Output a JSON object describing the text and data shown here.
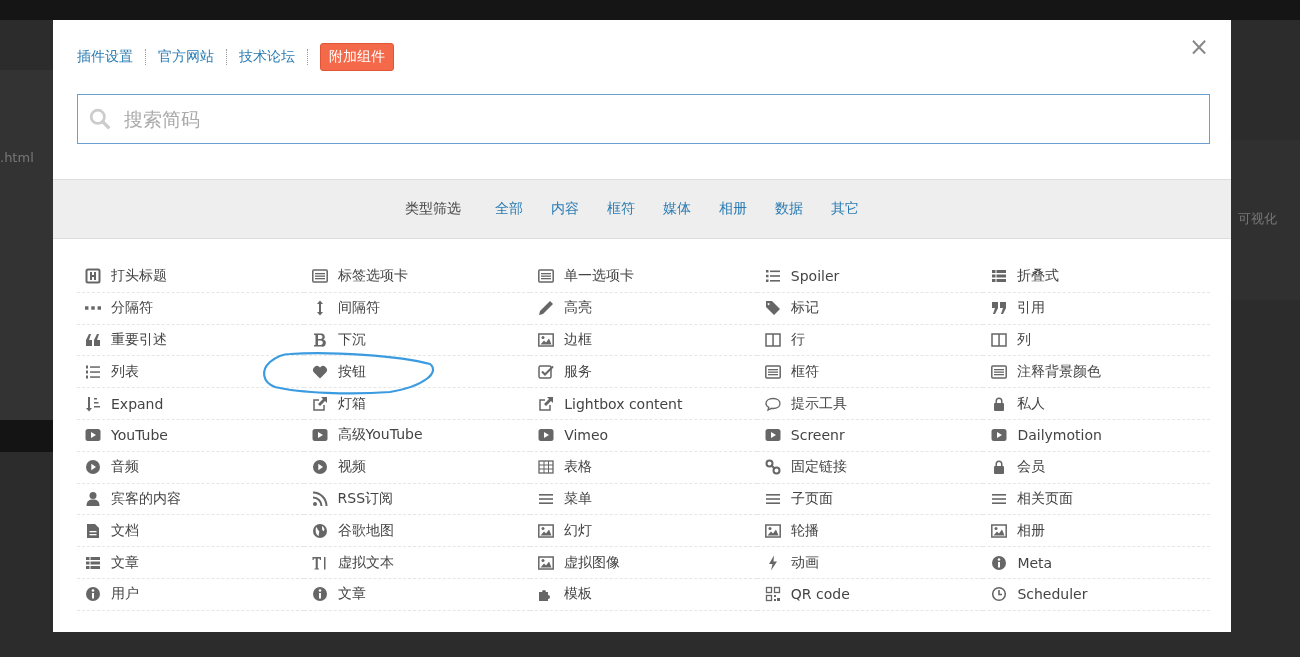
{
  "backdrop": {
    "left_text": ".html",
    "right_text": "可视化"
  },
  "header": {
    "links": [
      "插件设置",
      "官方网站",
      "技术论坛"
    ],
    "addon_button": "附加组件",
    "close": "×"
  },
  "search": {
    "placeholder": "搜索简码"
  },
  "filter": {
    "label": "类型筛选",
    "options": [
      "全部",
      "内容",
      "框符",
      "媒体",
      "相册",
      "数据",
      "其它"
    ]
  },
  "items": [
    {
      "kind": "heading",
      "label": "打头标题",
      "circled": false
    },
    {
      "kind": "list-alt",
      "label": "标签选项卡",
      "circled": false
    },
    {
      "kind": "list-alt",
      "label": "单一选项卡",
      "circled": false
    },
    {
      "kind": "list-ul",
      "label": "Spoiler",
      "circled": false
    },
    {
      "kind": "th-list",
      "label": "折叠式",
      "circled": false
    },
    {
      "kind": "ellipsis",
      "label": "分隔符",
      "circled": false
    },
    {
      "kind": "updown",
      "label": "间隔符",
      "circled": false
    },
    {
      "kind": "pencil",
      "label": "高亮",
      "circled": false
    },
    {
      "kind": "tag",
      "label": "标记",
      "circled": false
    },
    {
      "kind": "quote-right",
      "label": "引用",
      "circled": false
    },
    {
      "kind": "quote-left",
      "label": "重要引述",
      "circled": false
    },
    {
      "kind": "bold",
      "label": "下沉",
      "circled": false
    },
    {
      "kind": "image",
      "label": "边框",
      "circled": false
    },
    {
      "kind": "columns",
      "label": "行",
      "circled": false
    },
    {
      "kind": "columns",
      "label": "列",
      "circled": false
    },
    {
      "kind": "list-ol",
      "label": "列表",
      "circled": false
    },
    {
      "kind": "heart",
      "label": "按钮",
      "circled": true
    },
    {
      "kind": "check",
      "label": "服务",
      "circled": false
    },
    {
      "kind": "list-alt",
      "label": "框符",
      "circled": false
    },
    {
      "kind": "list-alt",
      "label": "注释背景颜色",
      "circled": false
    },
    {
      "kind": "sort",
      "label": "Expand",
      "circled": false
    },
    {
      "kind": "external",
      "label": "灯箱",
      "circled": false
    },
    {
      "kind": "external",
      "label": "Lightbox content",
      "circled": false
    },
    {
      "kind": "comment",
      "label": "提示工具",
      "circled": false
    },
    {
      "kind": "lock",
      "label": "私人",
      "circled": false
    },
    {
      "kind": "play",
      "label": "YouTube",
      "circled": false
    },
    {
      "kind": "play",
      "label": "高级YouTube",
      "circled": false
    },
    {
      "kind": "play",
      "label": "Vimeo",
      "circled": false
    },
    {
      "kind": "play",
      "label": "Screenr",
      "circled": false
    },
    {
      "kind": "play",
      "label": "Dailymotion",
      "circled": false
    },
    {
      "kind": "play-circle",
      "label": "音频",
      "circled": false
    },
    {
      "kind": "play-circle",
      "label": "视频",
      "circled": false
    },
    {
      "kind": "table",
      "label": "表格",
      "circled": false
    },
    {
      "kind": "link",
      "label": "固定链接",
      "circled": false
    },
    {
      "kind": "lock",
      "label": "会员",
      "circled": false
    },
    {
      "kind": "user",
      "label": "宾客的内容",
      "circled": false
    },
    {
      "kind": "rss",
      "label": "RSS订阅",
      "circled": false
    },
    {
      "kind": "bars",
      "label": "菜单",
      "circled": false
    },
    {
      "kind": "bars",
      "label": "子页面",
      "circled": false
    },
    {
      "kind": "bars",
      "label": "相关页面",
      "circled": false
    },
    {
      "kind": "file",
      "label": "文档",
      "circled": false
    },
    {
      "kind": "globe",
      "label": "谷歌地图",
      "circled": false
    },
    {
      "kind": "image",
      "label": "幻灯",
      "circled": false
    },
    {
      "kind": "image",
      "label": "轮播",
      "circled": false
    },
    {
      "kind": "image",
      "label": "相册",
      "circled": false
    },
    {
      "kind": "th-list",
      "label": "文章",
      "circled": false
    },
    {
      "kind": "text-height",
      "label": "虚拟文本",
      "circled": false
    },
    {
      "kind": "image",
      "label": "虚拟图像",
      "circled": false
    },
    {
      "kind": "bolt",
      "label": "动画",
      "circled": false
    },
    {
      "kind": "info",
      "label": "Meta",
      "circled": false
    },
    {
      "kind": "info",
      "label": "用户",
      "circled": false
    },
    {
      "kind": "info",
      "label": "文章",
      "circled": false
    },
    {
      "kind": "puzzle",
      "label": "模板",
      "circled": false
    },
    {
      "kind": "qrcode",
      "label": "QR code",
      "circled": false
    },
    {
      "kind": "clock",
      "label": "Scheduler",
      "circled": false
    }
  ]
}
